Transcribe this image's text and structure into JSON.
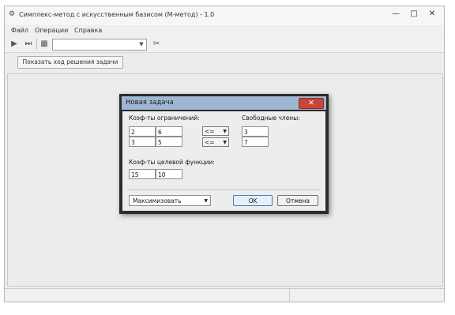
{
  "window": {
    "title": "Симплекс-метод с искусственным базисом (M-метод) - 1.0",
    "controls": {
      "minimize": "—",
      "maximize": "□",
      "close": "✕"
    }
  },
  "menu": [
    "Файл",
    "Операции",
    "Справка"
  ],
  "toolbar": {
    "icons": [
      "play-icon",
      "step-forward-icon",
      "sheet-icon",
      "tools-icon"
    ],
    "combo_value": ""
  },
  "show_button": "Показать ход решения задачи",
  "dialog": {
    "title": "Новая задача",
    "close": "✕",
    "coef_constraints_label": "Коэф-ты ограничений:",
    "constraints": [
      [
        "2",
        "6"
      ],
      [
        "3",
        "5"
      ]
    ],
    "signs": [
      "<=",
      "<="
    ],
    "rhs_label": "Свободные члены:",
    "rhs": [
      "3",
      "7"
    ],
    "objective_label": "Коэф-ты целевой функции:",
    "objective": [
      "15",
      "10"
    ],
    "mode": "Максимизовать",
    "ok": "OK",
    "cancel": "Отмена"
  }
}
